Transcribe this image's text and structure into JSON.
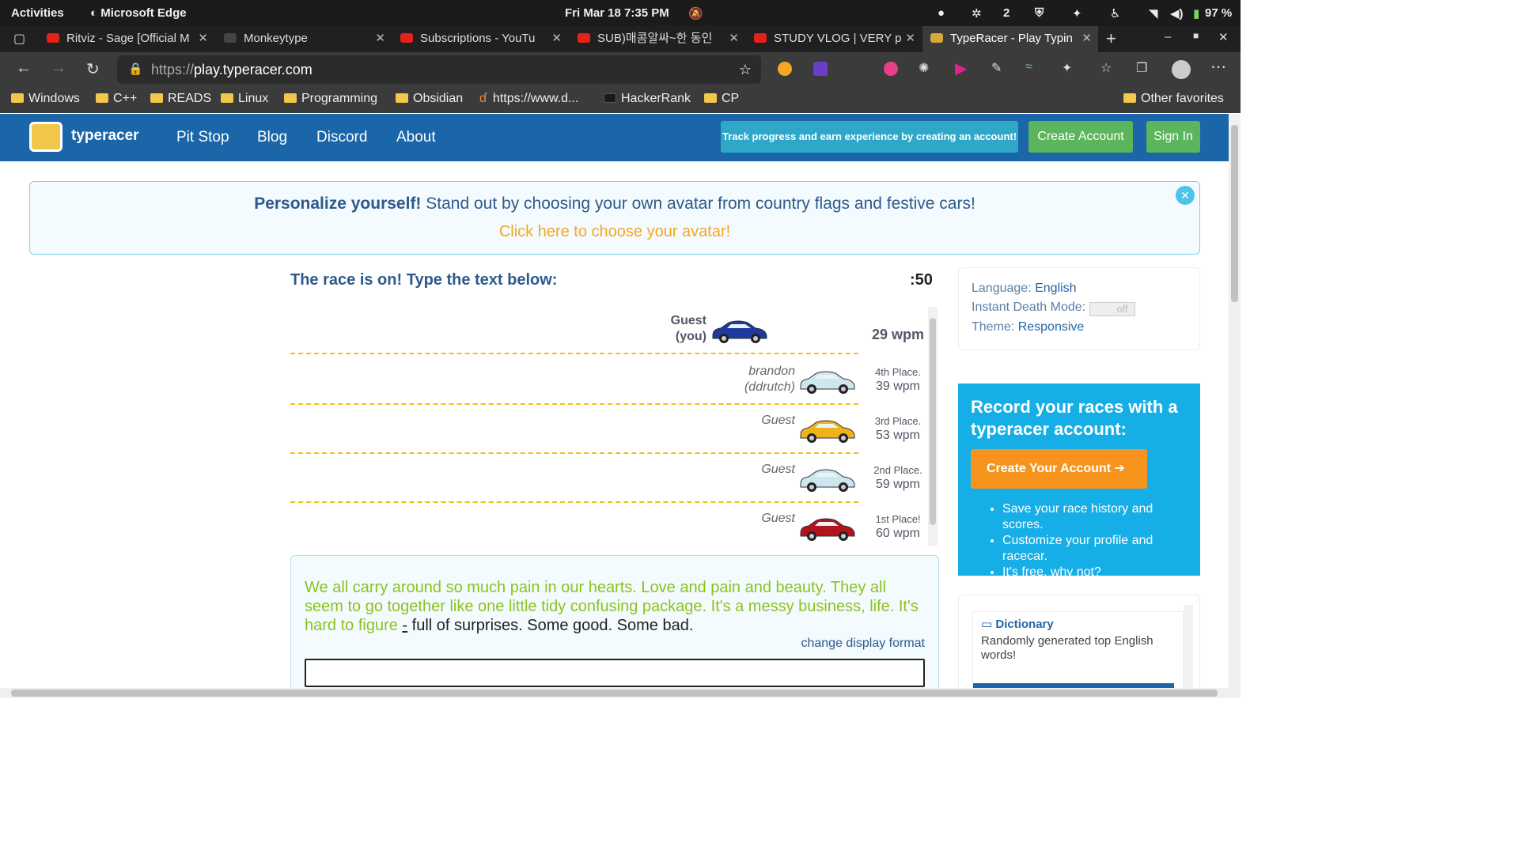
{
  "system": {
    "activities": "Activities",
    "app": "Microsoft Edge",
    "clock": "Fri Mar 18  7:35 PM",
    "count": "2",
    "battery": "97 %"
  },
  "tabs": [
    {
      "title": "Ritviz - Sage [Official M",
      "fav": "#e62117"
    },
    {
      "title": "Monkeytype",
      "fav": "#444"
    },
    {
      "title": "Subscriptions - YouTu",
      "fav": "#e62117"
    },
    {
      "title": "SUB)매콤알싸~한 동인",
      "fav": "#e62117"
    },
    {
      "title": "STUDY VLOG | VERY p",
      "fav": "#e62117"
    },
    {
      "title": "TypeRacer - Play Typin",
      "fav": "#d8a83a"
    }
  ],
  "address": {
    "scheme": "https://",
    "host": "play.typeracer.com"
  },
  "bookmarks": [
    "Windows",
    "C++",
    "READS",
    "Linux",
    "Programming",
    "Obsidian",
    "https://www.d...",
    "HackerRank",
    "CP",
    "Other favorites"
  ],
  "nav": {
    "logo": "typeracer",
    "links": [
      "Pit Stop",
      "Blog",
      "Discord",
      "About"
    ],
    "track": "Track progress and earn experience by creating an account!",
    "create": "Create Account",
    "signin": "Sign In"
  },
  "banner": {
    "bold": "Personalize yourself!",
    "text": " Stand out by choosing your own avatar from country flags and festive cars!",
    "link": "Click here to choose your avatar!"
  },
  "race": {
    "title": "The race is on! Type the text below:",
    "timer": ":50",
    "racers": [
      {
        "name1": "Guest",
        "name2": "(you)",
        "place": "",
        "wpm": "29 wpm",
        "color": "#1e3a9e"
      },
      {
        "name1": "brandon",
        "name2": "(ddrutch)",
        "place": "4th Place.",
        "wpm": "39 wpm",
        "color": "#cfe6ee"
      },
      {
        "name1": "Guest",
        "name2": "",
        "place": "3rd Place.",
        "wpm": "53 wpm",
        "color": "#f0b21b"
      },
      {
        "name1": "Guest",
        "name2": "",
        "place": "2nd Place.",
        "wpm": "59 wpm",
        "color": "#cfe6ee"
      },
      {
        "name1": "Guest",
        "name2": "",
        "place": "1st Place!",
        "wpm": "60 wpm",
        "color": "#b3141b"
      }
    ],
    "typed": "We all carry around so much pain in our hearts. Love and pain and beauty. They all seem to go together like one little tidy confusing package. It's a messy business, life. It's hard to figure ",
    "current": "-",
    "remaining": " full of surprises. Some good. Some bad.",
    "change_format": "change display format"
  },
  "settings": {
    "language_label": "Language:",
    "language": "English",
    "death_label": "Instant Death Mode:",
    "death_value": "off",
    "theme_label": "Theme:",
    "theme": "Responsive"
  },
  "promo": {
    "title": "Record your races with a typeracer account:",
    "button": "Create Your Account",
    "bullets": [
      "Save your race history and scores.",
      "Customize your profile and racecar.",
      "It's free, why not?"
    ]
  },
  "dictionary": {
    "title": "Dictionary",
    "desc": "Randomly generated top English words!"
  }
}
